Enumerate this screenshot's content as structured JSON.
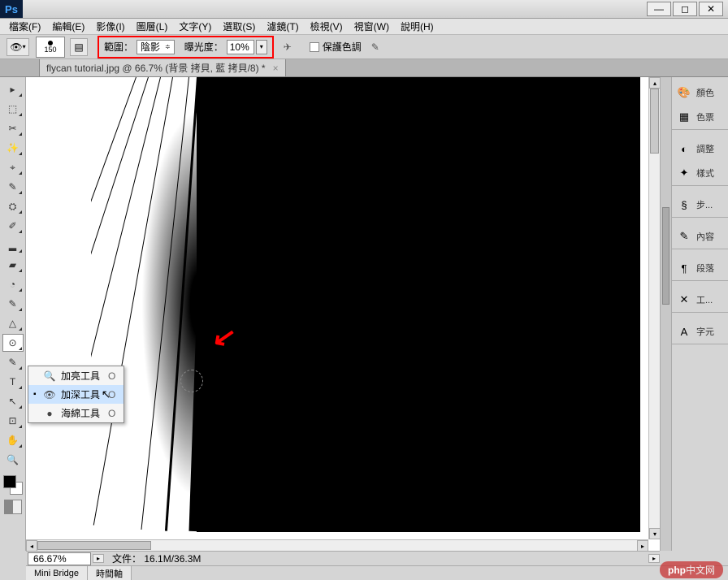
{
  "app": {
    "logo": "Ps"
  },
  "window": {
    "min": "—",
    "max": "◻",
    "close": "✕"
  },
  "menu": [
    "檔案(F)",
    "編輯(E)",
    "影像(I)",
    "圖層(L)",
    "文字(Y)",
    "選取(S)",
    "濾鏡(T)",
    "檢視(V)",
    "視窗(W)",
    "說明(H)"
  ],
  "options": {
    "brush_size": "150",
    "range_label": "範圍：",
    "range_value": "陰影",
    "exposure_label": "曝光度：",
    "exposure_value": "10%",
    "protect_label": "保護色調"
  },
  "tab": {
    "title": "flycan tutorial.jpg @ 66.7% (背景 拷貝, 藍 拷貝/8) *"
  },
  "flyout": {
    "items": [
      {
        "icon": "🔍",
        "label": "加亮工具",
        "key": "O",
        "selected": false
      },
      {
        "icon": "👁",
        "label": "加深工具",
        "key": "O",
        "selected": true
      },
      {
        "icon": "●",
        "label": "海綿工具",
        "key": "O",
        "selected": false
      }
    ]
  },
  "panels": [
    [
      {
        "icon": "🎨",
        "label": "顏色"
      },
      {
        "icon": "▦",
        "label": "色票"
      }
    ],
    [
      {
        "icon": "◐",
        "label": "調整"
      },
      {
        "icon": "✦",
        "label": "樣式"
      }
    ],
    [
      {
        "icon": "§",
        "label": "步..."
      }
    ],
    [
      {
        "icon": "✎",
        "label": "內容"
      }
    ],
    [
      {
        "icon": "¶",
        "label": "段落"
      }
    ],
    [
      {
        "icon": "✕",
        "label": "工..."
      }
    ],
    [
      {
        "icon": "A",
        "label": "字元"
      }
    ]
  ],
  "status": {
    "zoom": "66.67%",
    "doc_label": "文件：",
    "doc_info": "16.1M/36.3M"
  },
  "minitabs": [
    "Mini Bridge",
    "時間軸"
  ],
  "watermark": {
    "p": "php",
    "txt": "中文网"
  },
  "tool_glyphs": [
    "▸",
    "⬚",
    "✂",
    "✨",
    "⌖",
    "✎",
    "⛭",
    "✐",
    "▂",
    "▰",
    "◔",
    "✎",
    "△",
    "⊙",
    "◉",
    "✎",
    "T",
    "↖",
    "⊡",
    "✋",
    "🔍"
  ]
}
